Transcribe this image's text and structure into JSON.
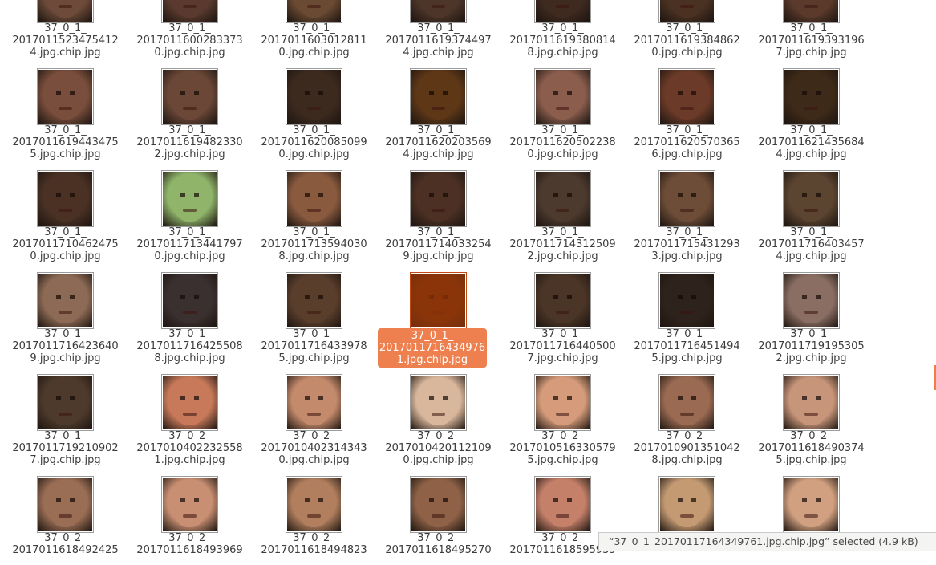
{
  "accent_color": "#ee7f4e",
  "status_text": "“37_0_1_20170117164349761.jpg.chip.jpg” selected (4.9 kB)",
  "selected_index": 24,
  "files": [
    {
      "name": "37_0_1_\n2017011523475412\n4.jpg.chip.jpg",
      "tone": "#6d4a39"
    },
    {
      "name": "37_0_1_\n2017011600283373\n0.jpg.chip.jpg",
      "tone": "#5a3a2e"
    },
    {
      "name": "37_0_1_\n2017011603012811\n0.jpg.chip.jpg",
      "tone": "#6b4a33"
    },
    {
      "name": "37_0_1_\n2017011619374497\n4.jpg.chip.jpg",
      "tone": "#4d3529"
    },
    {
      "name": "37_0_1_\n2017011619380814\n8.jpg.chip.jpg",
      "tone": "#3f2a20"
    },
    {
      "name": "37_0_1_\n2017011619384862\n0.jpg.chip.jpg",
      "tone": "#4a3122"
    },
    {
      "name": "37_0_1_\n2017011619393196\n7.jpg.chip.jpg",
      "tone": "#5b3a2c"
    },
    {
      "name": "37_0_1_\n2017011619443475\n5.jpg.chip.jpg",
      "tone": "#7a4e3c"
    },
    {
      "name": "37_0_1_\n2017011619482330\n2.jpg.chip.jpg",
      "tone": "#6a4737"
    },
    {
      "name": "37_0_1_\n2017011620085099\n0.jpg.chip.jpg",
      "tone": "#3d2a1f"
    },
    {
      "name": "37_0_1_\n2017011620203569\n4.jpg.chip.jpg",
      "tone": "#5e3717"
    },
    {
      "name": "37_0_1_\n2017011620502238\n0.jpg.chip.jpg",
      "tone": "#8a5d4d"
    },
    {
      "name": "37_0_1_\n2017011620570365\n6.jpg.chip.jpg",
      "tone": "#6b3a28"
    },
    {
      "name": "37_0_1_\n2017011621435684\n4.jpg.chip.jpg",
      "tone": "#3e2a18"
    },
    {
      "name": "37_0_1_\n2017011710462475\n0.jpg.chip.jpg",
      "tone": "#4a3124"
    },
    {
      "name": "37_0_1_\n2017011713441797\n0.jpg.chip.jpg",
      "tone": "#8fb46a"
    },
    {
      "name": "37_0_1_\n2017011713594030\n8.jpg.chip.jpg",
      "tone": "#8a5a3f"
    },
    {
      "name": "37_0_1_\n2017011714033254\n9.jpg.chip.jpg",
      "tone": "#4b3023"
    },
    {
      "name": "37_0_1_\n2017011714312509\n2.jpg.chip.jpg",
      "tone": "#4d3a2e"
    },
    {
      "name": "37_0_1_\n2017011715431293\n3.jpg.chip.jpg",
      "tone": "#6e4d38"
    },
    {
      "name": "37_0_1_\n2017011716403457\n4.jpg.chip.jpg",
      "tone": "#5b4430"
    },
    {
      "name": "37_0_1_\n2017011716423640\n9.jpg.chip.jpg",
      "tone": "#8d6a55"
    },
    {
      "name": "37_0_1_\n2017011716425508\n8.jpg.chip.jpg",
      "tone": "#3a3030"
    },
    {
      "name": "37_0_1_\n2017011716433978\n5.jpg.chip.jpg",
      "tone": "#5a3e2c"
    },
    {
      "name": "37_0_1_\n2017011716434976\n1.jpg.chip.jpg",
      "tone": "#4a1e08"
    },
    {
      "name": "37_0_1_\n2017011716440500\n7.jpg.chip.jpg",
      "tone": "#4a3526"
    },
    {
      "name": "37_0_1_\n2017011716451494\n5.jpg.chip.jpg",
      "tone": "#2e231c"
    },
    {
      "name": "37_0_1_\n2017011719195305\n2.jpg.chip.jpg",
      "tone": "#8a6e63"
    },
    {
      "name": "37_0_1_\n2017011719210902\n7.jpg.chip.jpg",
      "tone": "#4e3a2c"
    },
    {
      "name": "37_0_2_\n2017010402232558\n1.jpg.chip.jpg",
      "tone": "#c7795a"
    },
    {
      "name": "37_0_2_\n2017010402314343\n0.jpg.chip.jpg",
      "tone": "#c48a6c"
    },
    {
      "name": "37_0_2_\n2017010420112109\n0.jpg.chip.jpg",
      "tone": "#d9b79c"
    },
    {
      "name": "37_0_2_\n2017010516330579\n5.jpg.chip.jpg",
      "tone": "#d59b7a"
    },
    {
      "name": "37_0_2_\n2017010901351042\n8.jpg.chip.jpg",
      "tone": "#9a6a52"
    },
    {
      "name": "37_0_2_\n2017011618490374\n5.jpg.chip.jpg",
      "tone": "#c7957a"
    },
    {
      "name": "37_0_2_\n2017011618492425",
      "tone": "#9a6d55"
    },
    {
      "name": "37_0_2_\n2017011618493969",
      "tone": "#c98f73"
    },
    {
      "name": "37_0_2_\n2017011618494823",
      "tone": "#b17f5e"
    },
    {
      "name": "37_0_2_\n2017011618495270",
      "tone": "#8f6247"
    },
    {
      "name": "37_0_2_\n2017011618595935",
      "tone": "#c5806a"
    },
    {
      "name": "",
      "tone": "#c49a73"
    },
    {
      "name": "",
      "tone": "#d0a080"
    }
  ]
}
